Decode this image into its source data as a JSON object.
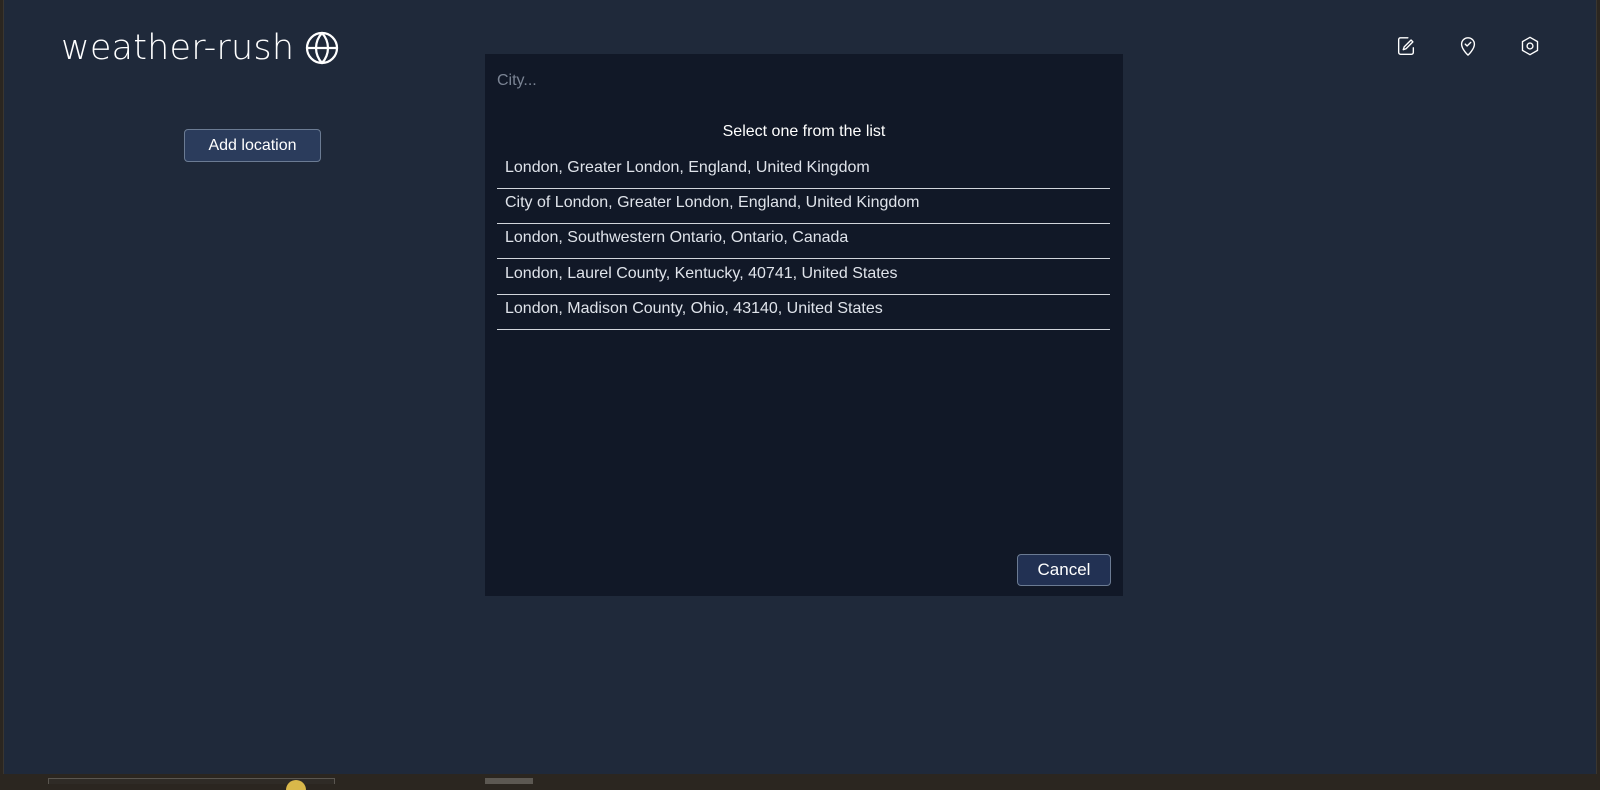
{
  "app": {
    "title": "weather-rush"
  },
  "header": {
    "icons": [
      "edit-icon",
      "location-check-icon",
      "settings-icon"
    ]
  },
  "sidebar": {
    "add_location_label": "Add location"
  },
  "search": {
    "placeholder": "City...",
    "value": "",
    "heading": "Select one from the list",
    "results": [
      "London, Greater London, England, United Kingdom",
      "City of London, Greater London, England, United Kingdom",
      "London, Southwestern Ontario, Ontario, Canada",
      "London, Laurel County, Kentucky, 40741, United States",
      "London, Madison County, Ohio, 43140, United States"
    ],
    "cancel_label": "Cancel"
  },
  "colors": {
    "background": "#1f293a",
    "panel": "#111827",
    "button": "#2b3c5c",
    "text": "#ffffff"
  }
}
